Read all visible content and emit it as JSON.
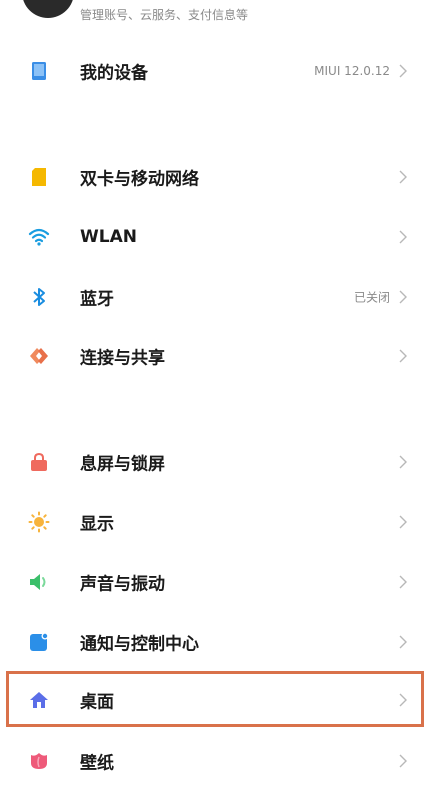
{
  "account": {
    "subtitle": "管理账号、云服务、支付信息等"
  },
  "groups": [
    {
      "items": [
        {
          "label": "我的设备",
          "value": "MIUI 12.0.12",
          "icon": "device-icon"
        }
      ]
    },
    {
      "items": [
        {
          "label": "双卡与移动网络",
          "value": "",
          "icon": "sim-card-icon"
        },
        {
          "label": "WLAN",
          "value": "",
          "icon": "wifi-icon"
        },
        {
          "label": "蓝牙",
          "value": "已关闭",
          "icon": "bluetooth-icon"
        },
        {
          "label": "连接与共享",
          "value": "",
          "icon": "connection-sharing-icon"
        }
      ]
    },
    {
      "items": [
        {
          "label": "息屏与锁屏",
          "value": "",
          "icon": "lock-icon"
        },
        {
          "label": "显示",
          "value": "",
          "icon": "sun-icon"
        },
        {
          "label": "声音与振动",
          "value": "",
          "icon": "speaker-icon"
        },
        {
          "label": "通知与控制中心",
          "value": "",
          "icon": "notification-icon"
        },
        {
          "label": "桌面",
          "value": "",
          "icon": "home-icon"
        },
        {
          "label": "壁纸",
          "value": "",
          "icon": "flower-icon"
        }
      ]
    }
  ],
  "colors": {
    "device": "#3a8ee6",
    "sim": "#f5b800",
    "wifi": "#1a9de0",
    "bluetooth": "#1a8de0",
    "share": "#e8704a",
    "lock": "#ef6a5e",
    "sun": "#f7b33b",
    "sound": "#3bbf6a",
    "notify": "#2b8fe8",
    "home": "#5b6ee8",
    "wallpaper": "#ee5a7a",
    "highlight": "#d9714a"
  }
}
